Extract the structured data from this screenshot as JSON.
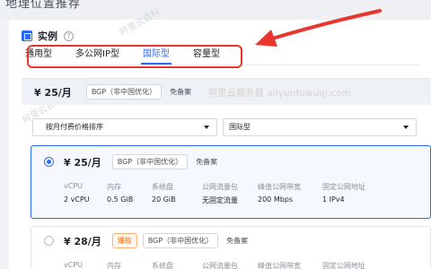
{
  "header_fragment": "地理位置推荐",
  "watermark": "阿里云百科",
  "section": {
    "title": "实例",
    "help": "?"
  },
  "tabs": [
    {
      "label": "通用型"
    },
    {
      "label": "多公网IP型"
    },
    {
      "label": "国际型",
      "active": true
    },
    {
      "label": "容量型"
    }
  ],
  "summary": {
    "price": "¥ 25/月",
    "network_tag": "BGP（非中国优化）",
    "filing_tag": "免备案",
    "promo_text": "阿里云服务器 aliyunfuwuqi.com"
  },
  "filters": {
    "sort_value": "按月付费价格排序",
    "region_value": "国际型"
  },
  "spec_headers": [
    "vCPU",
    "内存",
    "系统盘",
    "公网流量包",
    "峰值公网带宽",
    "固定公网地址"
  ],
  "options": [
    {
      "price": "¥ 25/月",
      "network_tag": "BGP（非中国优化）",
      "filing_tag": "免备案",
      "selected": true,
      "specs": [
        "2 vCPU",
        "0.5 GiB",
        "20 GiB",
        "无固定流量",
        "200 Mbps",
        "1 IPv4"
      ]
    },
    {
      "price": "¥ 28/月",
      "hot_tag": "爆款",
      "network_tag": "BGP（非中国优化）",
      "filing_tag": "免备案",
      "selected": false
    }
  ],
  "colors": {
    "accent": "#2b6bf3",
    "highlight_red": "#e8362e",
    "hot_orange": "#ff6a00"
  }
}
